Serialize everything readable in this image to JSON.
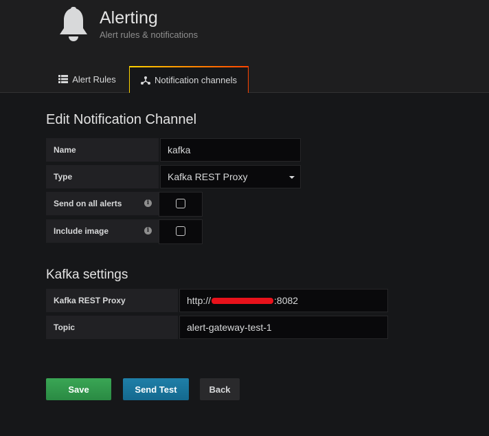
{
  "header": {
    "title": "Alerting",
    "subtitle": "Alert rules & notifications",
    "icon": "bell-icon"
  },
  "tabs": [
    {
      "label": "Alert Rules",
      "icon": "list-icon",
      "active": false
    },
    {
      "label": "Notification channels",
      "icon": "share-icon",
      "active": true
    }
  ],
  "form": {
    "title": "Edit Notification Channel",
    "name_label": "Name",
    "name_value": "kafka",
    "type_label": "Type",
    "type_value": "Kafka REST Proxy",
    "send_all_label": "Send on all alerts",
    "send_all_checked": false,
    "include_image_label": "Include image",
    "include_image_checked": false
  },
  "kafka": {
    "title": "Kafka settings",
    "proxy_label": "Kafka REST Proxy",
    "proxy_value_prefix": "http://",
    "proxy_value_suffix": ":8082",
    "topic_label": "Topic",
    "topic_value": "alert-gateway-test-1"
  },
  "buttons": {
    "save": "Save",
    "send_test": "Send Test",
    "back": "Back"
  },
  "colors": {
    "save": "#2f9a4b",
    "send_test": "#1776a0",
    "back": "#2a2a2c",
    "tab_accent_start": "#ffd500",
    "tab_accent_end": "#ff4400"
  }
}
